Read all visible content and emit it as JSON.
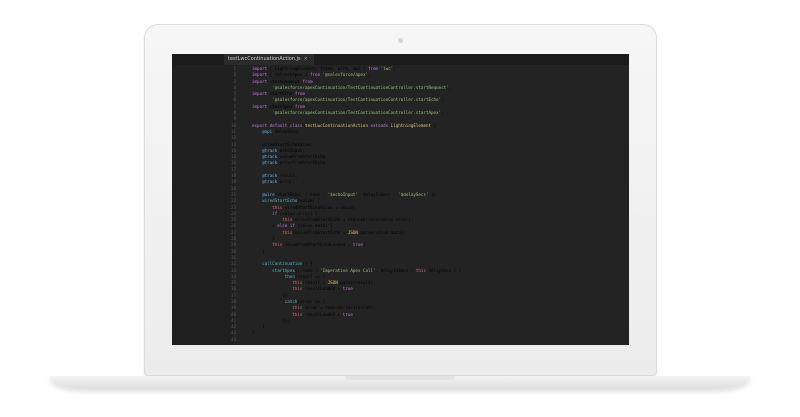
{
  "editor": {
    "tab_title": "testLwcContinuationAction.js",
    "tab_close": "×",
    "lines": [
      {
        "n": "1",
        "segs": [
          [
            "kw",
            "import"
          ],
          [
            "txt",
            " { LightningElement, track, wire, api } "
          ],
          [
            "kw",
            "from"
          ],
          [
            "str",
            " 'lwc'"
          ],
          [
            "txt",
            ";"
          ]
        ]
      },
      {
        "n": "2",
        "segs": [
          [
            "kw",
            "import"
          ],
          [
            "txt",
            " { refreshApex } "
          ],
          [
            "kw",
            "from"
          ],
          [
            "str",
            " '@salesforce/apex'"
          ],
          [
            "txt",
            ";"
          ]
        ]
      },
      {
        "n": "3",
        "segs": [
          [
            "kw",
            "import"
          ],
          [
            "txt",
            " startRequest "
          ],
          [
            "kw",
            "from"
          ]
        ]
      },
      {
        "n": "4",
        "segs": [
          [
            "str",
            "        '@salesforce/apexContinuation/TestContinuationController.startRequest'"
          ],
          [
            "txt",
            ";"
          ]
        ]
      },
      {
        "n": "5",
        "segs": [
          [
            "kw",
            "import"
          ],
          [
            "txt",
            " startEcho "
          ],
          [
            "kw",
            "from"
          ]
        ]
      },
      {
        "n": "6",
        "segs": [
          [
            "str",
            "        '@salesforce/apexContinuation/TestContinuationController.startEcho'"
          ],
          [
            "txt",
            ";"
          ]
        ]
      },
      {
        "n": "7",
        "segs": [
          [
            "kw",
            "import"
          ],
          [
            "txt",
            " startApex "
          ],
          [
            "kw",
            "from"
          ]
        ]
      },
      {
        "n": "8",
        "segs": [
          [
            "str",
            "        '@salesforce/apexContinuation/TestContinuationController.startApex'"
          ],
          [
            "txt",
            ";"
          ]
        ]
      },
      {
        "n": "9",
        "segs": [
          [
            "txt",
            ""
          ]
        ]
      },
      {
        "n": "10",
        "segs": [
          [
            "kw",
            "export default class"
          ],
          [
            "var",
            " testLwcContinuationAction"
          ],
          [
            "kw",
            " extends"
          ],
          [
            "var",
            " LightningElement"
          ],
          [
            "txt",
            " {"
          ]
        ]
      },
      {
        "n": "11",
        "segs": [
          [
            "dec",
            "    @api"
          ],
          [
            "txt",
            " delaySecs;"
          ]
        ]
      },
      {
        "n": "12",
        "segs": [
          [
            "txt",
            ""
          ]
        ]
      },
      {
        "n": "13",
        "segs": [
          [
            "txt",
            "    wiredStartEchoValue;"
          ]
        ]
      },
      {
        "n": "14",
        "segs": [
          [
            "dec",
            "    @track"
          ],
          [
            "txt",
            " echoInput;"
          ]
        ]
      },
      {
        "n": "15",
        "segs": [
          [
            "dec",
            "    @track"
          ],
          [
            "txt",
            " valueFromStartEcho;"
          ]
        ]
      },
      {
        "n": "16",
        "segs": [
          [
            "dec",
            "    @track"
          ],
          [
            "txt",
            " errorFromStartEcho;"
          ]
        ]
      },
      {
        "n": "17",
        "segs": [
          [
            "txt",
            ""
          ]
        ]
      },
      {
        "n": "18",
        "segs": [
          [
            "dec",
            "    @track"
          ],
          [
            "txt",
            " result;"
          ]
        ]
      },
      {
        "n": "19",
        "segs": [
          [
            "dec",
            "    @track"
          ],
          [
            "txt",
            " error;"
          ]
        ]
      },
      {
        "n": "20",
        "segs": [
          [
            "txt",
            ""
          ]
        ]
      },
      {
        "n": "21",
        "segs": [
          [
            "dec",
            "    @wire"
          ],
          [
            "txt",
            "(startEcho, { name : "
          ],
          [
            "str",
            "'$echoInput'"
          ],
          [
            "txt",
            ", delayInSecs : "
          ],
          [
            "str",
            "'$delaySecs'"
          ],
          [
            "txt",
            " })"
          ]
        ]
      },
      {
        "n": "22",
        "segs": [
          [
            "fn",
            "    wiredStartEcho"
          ],
          [
            "txt",
            "(value) {"
          ]
        ]
      },
      {
        "n": "23",
        "segs": [
          [
            "this",
            "        this"
          ],
          [
            "txt",
            ".wiredStartEchoValue = value;"
          ]
        ]
      },
      {
        "n": "24",
        "segs": [
          [
            "kw",
            "        if"
          ],
          [
            "txt",
            " (value.error) {"
          ]
        ]
      },
      {
        "n": "25",
        "segs": [
          [
            "this",
            "            this"
          ],
          [
            "txt",
            ".errorFromStartEcho = reduceErrors(value.error);"
          ]
        ]
      },
      {
        "n": "26",
        "segs": [
          [
            "txt",
            "        } "
          ],
          [
            "kw",
            "else if"
          ],
          [
            "txt",
            " (value.data) {"
          ]
        ]
      },
      {
        "n": "27",
        "segs": [
          [
            "this",
            "            this"
          ],
          [
            "txt",
            ".valueFromStartEcho = "
          ],
          [
            "var",
            "JSON"
          ],
          [
            "txt",
            ".parse(value.data);"
          ]
        ]
      },
      {
        "n": "28",
        "segs": [
          [
            "txt",
            "        }"
          ]
        ]
      },
      {
        "n": "29",
        "segs": [
          [
            "this",
            "        this"
          ],
          [
            "txt",
            ".valueFromStartEchoLoaded = "
          ],
          [
            "kw",
            "true"
          ],
          [
            "txt",
            ";"
          ]
        ]
      },
      {
        "n": "30",
        "segs": [
          [
            "txt",
            "    }"
          ]
        ]
      },
      {
        "n": "31",
        "segs": [
          [
            "txt",
            ""
          ]
        ]
      },
      {
        "n": "32",
        "segs": [
          [
            "fn",
            "    callContinuation"
          ],
          [
            "txt",
            "() {"
          ]
        ]
      },
      {
        "n": "33",
        "segs": [
          [
            "fn",
            "        startApex"
          ],
          [
            "txt",
            "({ name : "
          ],
          [
            "str",
            "'Imperative Apex Call'"
          ],
          [
            "txt",
            ", delayInSecs : "
          ],
          [
            "this",
            "this"
          ],
          [
            "txt",
            ".delaySecs } )"
          ]
        ]
      },
      {
        "n": "34",
        "segs": [
          [
            "txt",
            "            ."
          ],
          [
            "fn",
            "then"
          ],
          [
            "txt",
            "(result => {"
          ]
        ]
      },
      {
        "n": "35",
        "segs": [
          [
            "this",
            "                this"
          ],
          [
            "txt",
            ".result = "
          ],
          [
            "var",
            "JSON"
          ],
          [
            "txt",
            ".parse(result);"
          ]
        ]
      },
      {
        "n": "36",
        "segs": [
          [
            "this",
            "                this"
          ],
          [
            "txt",
            ".resultLoaded = "
          ],
          [
            "kw",
            "true"
          ],
          [
            "txt",
            ";"
          ]
        ]
      },
      {
        "n": "37",
        "segs": [
          [
            "txt",
            "            })"
          ]
        ]
      },
      {
        "n": "38",
        "segs": [
          [
            "txt",
            "            ."
          ],
          [
            "fn",
            "catch"
          ],
          [
            "txt",
            "(error => {"
          ]
        ]
      },
      {
        "n": "39",
        "segs": [
          [
            "this",
            "                this"
          ],
          [
            "txt",
            ".error = reduceErrors(error);"
          ]
        ]
      },
      {
        "n": "40",
        "segs": [
          [
            "this",
            "                this"
          ],
          [
            "txt",
            ".resultLoaded = "
          ],
          [
            "kw",
            "true"
          ],
          [
            "txt",
            ";"
          ]
        ]
      },
      {
        "n": "41",
        "segs": [
          [
            "txt",
            "            });"
          ]
        ]
      },
      {
        "n": "42",
        "segs": [
          [
            "txt",
            "    }"
          ]
        ]
      },
      {
        "n": "43",
        "segs": [
          [
            "txt",
            "}"
          ]
        ]
      },
      {
        "n": "44",
        "segs": [
          [
            "txt",
            ""
          ]
        ]
      }
    ]
  },
  "colors": {
    "editor_background": "#232323",
    "gutter_background": "#1f1f1f",
    "keyword": "#c678dd",
    "string": "#98c379",
    "decorator": "#61afef"
  }
}
